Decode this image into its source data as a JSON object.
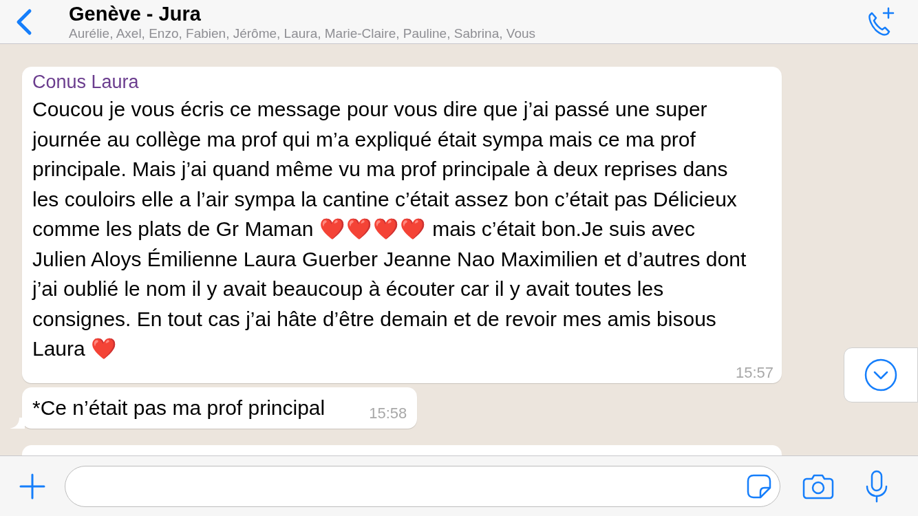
{
  "header": {
    "title": "Genève - Jura",
    "members": "Aurélie, Axel, Enzo, Fabien, Jérôme, Laura, Marie-Claire, Pauline, Sabrina, Vous"
  },
  "messages": [
    {
      "kind": "incoming",
      "sender": "Conus Laura",
      "color": "#6b3d8e",
      "parts": [
        {
          "kind": "text",
          "text": "Coucou je vous écris ce message pour vous dire que j’ai passé une super journée au collège ma prof qui m’a expliqué était sympa mais ce ma prof principale. Mais j’ai quand même vu ma prof principale à deux reprises dans les couloirs elle a l’air sympa la cantine c’était assez bon c’était pas Délicieux comme les plats de Gr Maman "
        },
        {
          "kind": "emoji",
          "text": "❤️❤️❤️❤️"
        },
        {
          "kind": "text",
          "text": " mais c’était bon.Je suis avec Julien Aloys Émilienne Laura Guerber Jeanne Nao Maximilien et d’autres dont  j’ai oublié le nom il y avait beaucoup à écouter car il y avait toutes les consignes. En tout cas j’ai hâte d’être demain et de revoir mes amis bisous Laura "
        },
        {
          "kind": "emoji",
          "text": "❤️"
        }
      ],
      "time": "15:57",
      "tail": false
    },
    {
      "kind": "incoming",
      "parts": [
        {
          "kind": "text",
          "text": "*Ce n’était pas ma prof principal"
        }
      ],
      "time": "15:58",
      "tail": true
    },
    {
      "kind": "cut"
    }
  ]
}
